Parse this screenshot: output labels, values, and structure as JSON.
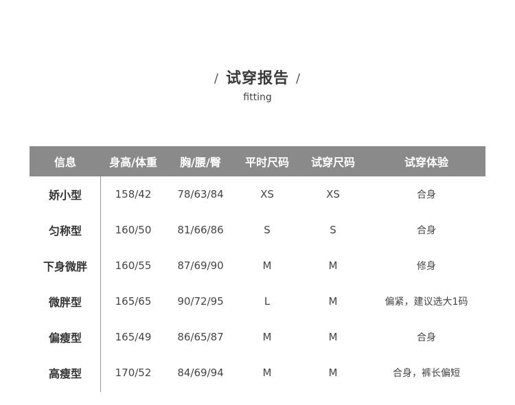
{
  "title": {
    "left_slash": "/",
    "text": "试穿报告",
    "right_slash": "/",
    "subtitle": "fitting"
  },
  "table": {
    "headers": [
      "信息",
      "身高/体重",
      "胸/腰/臀",
      "平时尺码",
      "试穿尺码",
      "试穿体验"
    ],
    "rows": [
      [
        "娇小型",
        "158/42",
        "78/63/84",
        "XS",
        "XS",
        "合身"
      ],
      [
        "匀称型",
        "160/50",
        "81/66/86",
        "S",
        "S",
        "合身"
      ],
      [
        "下身微胖",
        "160/55",
        "87/69/90",
        "M",
        "M",
        "修身"
      ],
      [
        "微胖型",
        "165/65",
        "90/72/95",
        "L",
        "M",
        "偏紧，建议选大1码"
      ],
      [
        "偏瘦型",
        "165/49",
        "86/65/87",
        "M",
        "M",
        "合身"
      ],
      [
        "高瘦型",
        "170/52",
        "84/69/94",
        "M",
        "M",
        "合身，裤长偏短"
      ]
    ]
  },
  "colors": {
    "header_bg": "#8a8a8a",
    "header_text": "#ffffff",
    "text": "#444444"
  }
}
